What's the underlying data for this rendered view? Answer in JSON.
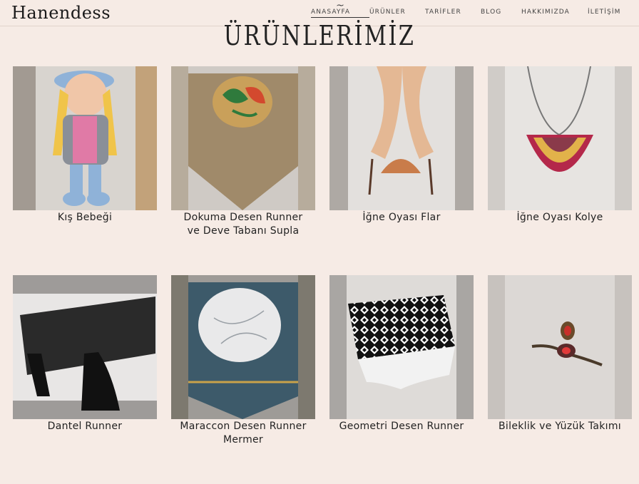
{
  "brand": {
    "logo_text": "Hanendess"
  },
  "nav": {
    "items": [
      {
        "label": "ANASAYFA",
        "active": true
      },
      {
        "label": "ÜRÜNLER",
        "active": false
      },
      {
        "label": "TARİFLER",
        "active": false
      },
      {
        "label": "BLOG",
        "active": false
      },
      {
        "label": "HAKKIMIZDA",
        "active": false
      },
      {
        "label": "İLETİŞİM",
        "active": false
      }
    ],
    "active_mark": "~"
  },
  "page": {
    "title": "ÜRÜNLERİMİZ"
  },
  "products": [
    {
      "name": "Kış Bebeği"
    },
    {
      "name": "Dokuma Desen Runner ve Deve Tabanı Supla"
    },
    {
      "name": "İğne Oyası Flar"
    },
    {
      "name": "İğne Oyası Kolye"
    },
    {
      "name": "Dantel Runner"
    },
    {
      "name": "Maraccon Desen Runner Mermer"
    },
    {
      "name": "Geometri Desen Runner"
    },
    {
      "name": "Bileklik ve Yüzük Takımı"
    }
  ]
}
